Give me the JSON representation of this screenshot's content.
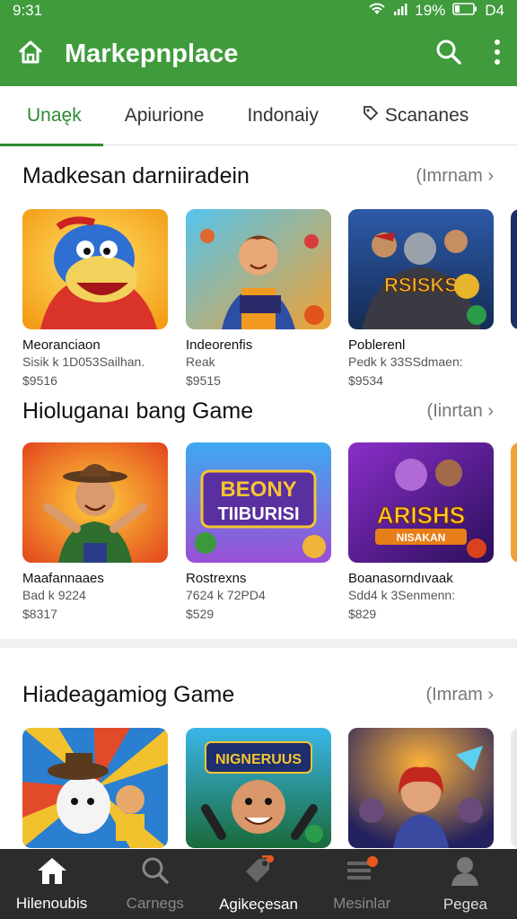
{
  "status": {
    "time": "9:31",
    "battery": "19%",
    "extra": "D4"
  },
  "appbar": {
    "title": "Markepnplace",
    "home_icon": "home-icon",
    "search_icon": "search-icon",
    "menu_icon": "more-vert-icon"
  },
  "tabs": [
    {
      "label": "Unaęk",
      "active": true
    },
    {
      "label": "Apiurione",
      "active": false
    },
    {
      "label": "Indonaiy",
      "active": false
    },
    {
      "label": "Scananes",
      "active": false
    }
  ],
  "sections": [
    {
      "title": "Madkesan darniiradein",
      "more": "(Imrnam ›",
      "items": [
        {
          "name": "Meoranciaon",
          "meta": "Sisik k 1D053Sailhan.",
          "price": "$9516"
        },
        {
          "name": "Indeorenfis",
          "meta": "Reak",
          "price": "$9515"
        },
        {
          "name": "Poblerenl",
          "meta": "Pedk k 33SSdmaen:",
          "price": "$9534"
        }
      ]
    },
    {
      "title": "Hioluganaı bang Game",
      "more": "(Iinrtan ›",
      "items": [
        {
          "name": "Maafannaaes",
          "meta": "Bad k 9224",
          "price": "$8317"
        },
        {
          "name": "Rostrexns",
          "meta": "7624 k 72PD4",
          "price": "$529"
        },
        {
          "name": "Boanasorndıvaak",
          "meta": "Sdd4 k 3Senmenn:",
          "price": "$829"
        }
      ]
    },
    {
      "title": "Hiadeagamiog Game",
      "more": "(Imram ›",
      "items": [
        {
          "name": "",
          "meta": "",
          "price": ""
        },
        {
          "name": "",
          "meta": "",
          "price": ""
        },
        {
          "name": "",
          "meta": "",
          "price": ""
        }
      ]
    }
  ],
  "thumb_text": {
    "s0_2": "RSISKS",
    "s1_1_a": "BEONY",
    "s1_1_b": "TIIBURISI",
    "s1_2_a": "ARISHS",
    "s1_2_b": "NISAKAN",
    "s2_1": "NIGNERUUS"
  },
  "bottom_nav": [
    {
      "label": "Hilenoubis",
      "icon": "home-icon",
      "active": true
    },
    {
      "label": "Carnegs",
      "icon": "search-icon",
      "active": false
    },
    {
      "label": "Agikeçesan",
      "icon": "tag-icon",
      "active": false
    },
    {
      "label": "Mesinlar",
      "icon": "list-icon",
      "active": false
    },
    {
      "label": "Pegea",
      "icon": "profile-icon",
      "active": false
    }
  ],
  "colors": {
    "accent": "#3f9b3c",
    "tab_active": "#2f8a30",
    "nav_bg": "#2c2c2c"
  }
}
